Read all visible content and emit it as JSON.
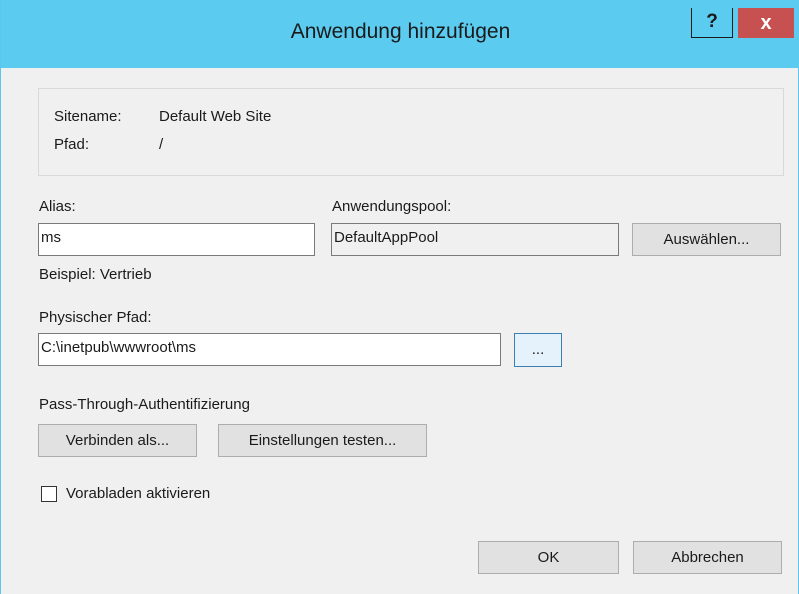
{
  "window": {
    "title": "Anwendung hinzufügen",
    "help_label": "?",
    "close_label": "x"
  },
  "site_info": {
    "sitename_label": "Sitename:",
    "sitename_value": "Default Web Site",
    "path_label": "Pfad:",
    "path_value": "/"
  },
  "alias": {
    "label": "Alias:",
    "value": "ms",
    "example": "Beispiel: Vertrieb"
  },
  "app_pool": {
    "label": "Anwendungspool:",
    "value": "DefaultAppPool",
    "select_button": "Auswählen..."
  },
  "physical_path": {
    "label": "Physischer Pfad:",
    "value": "C:\\inetpub\\wwwroot\\ms",
    "browse_button": "..."
  },
  "pass_through": {
    "label": "Pass-Through-Authentifizierung",
    "connect_as_button": "Verbinden als...",
    "test_settings_button": "Einstellungen testen..."
  },
  "preload": {
    "label": "Vorabladen aktivieren",
    "checked": false
  },
  "footer": {
    "ok_label": "OK",
    "cancel_label": "Abbrechen"
  },
  "colors": {
    "titlebar": "#5bcbf0",
    "close": "#c75050",
    "dialog_bg": "#f0f0f0"
  }
}
